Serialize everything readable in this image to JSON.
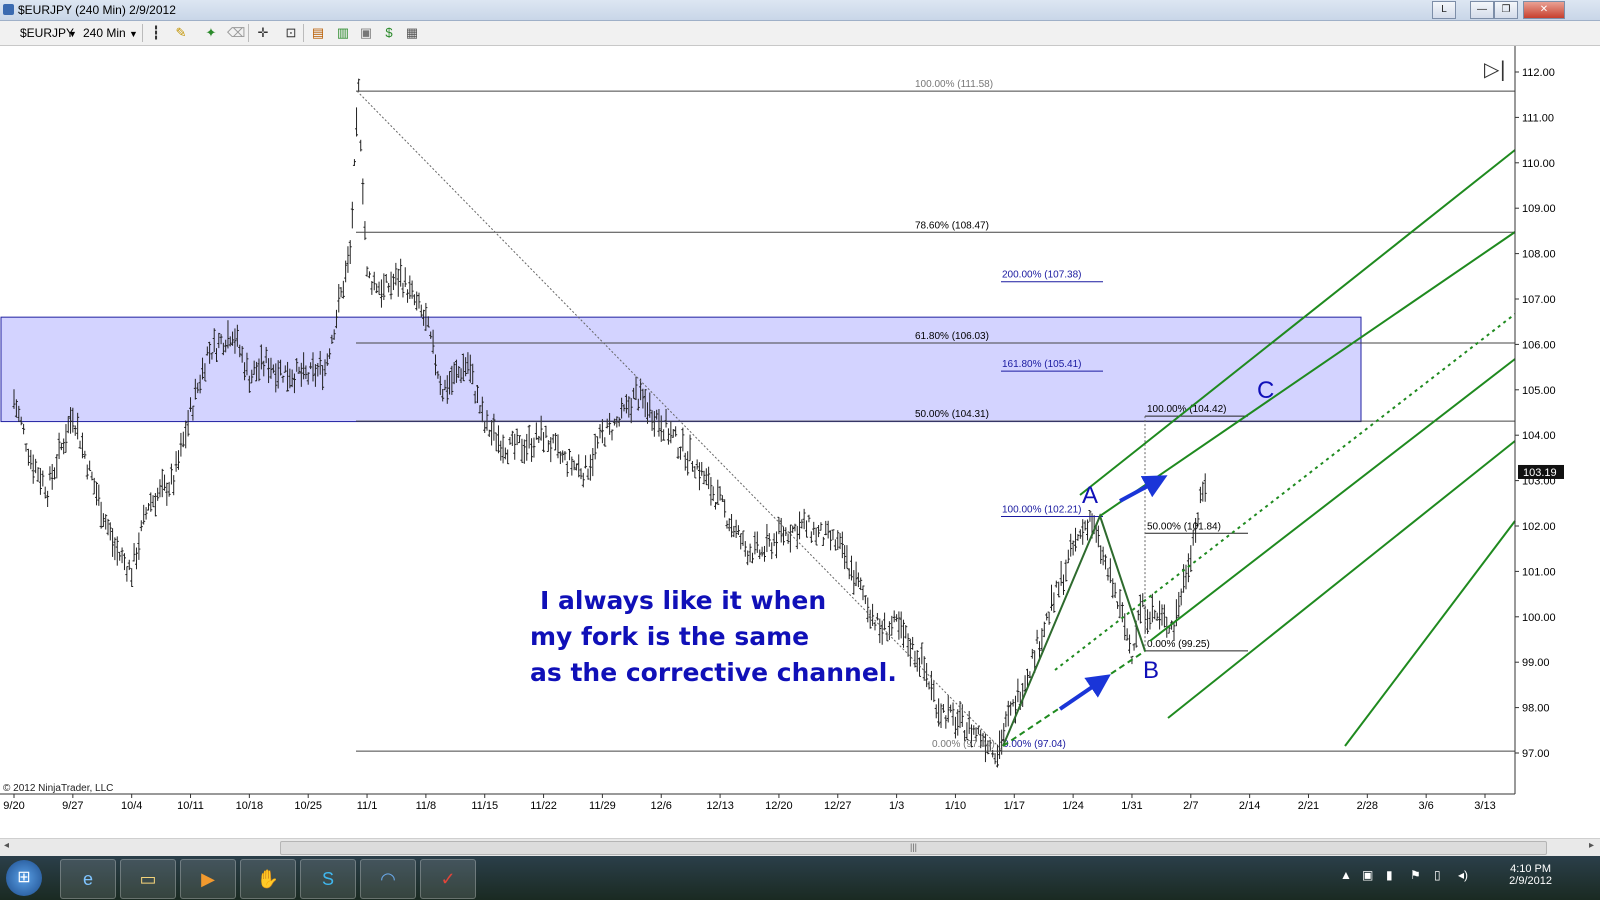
{
  "window": {
    "title": "$EURJPY (240 Min)  2/9/2012",
    "buttons": [
      "L",
      "—",
      "❐",
      "✕"
    ]
  },
  "toolbar": {
    "instrument": "$EURJPY",
    "interval": "240 Min",
    "icons": [
      "bar-type-icon",
      "pencil-icon",
      "magic-wand-icon",
      "eraser-icon",
      "crosshair-icon",
      "zoom-icon",
      "properties-icon",
      "strategy-icon",
      "chart-trader-icon",
      "dollar-icon",
      "data-box-icon"
    ]
  },
  "chart_data": {
    "type": "line",
    "title": "",
    "xlabel": "",
    "ylabel": "",
    "ylim": [
      96.7,
      112.3
    ],
    "yticks": [
      "112.00",
      "111.00",
      "110.00",
      "109.00",
      "108.00",
      "107.00",
      "106.00",
      "105.00",
      "104.00",
      "103.00",
      "102.00",
      "101.00",
      "100.00",
      "99.00",
      "98.00",
      "97.00"
    ],
    "xticks": [
      "9/20",
      "9/27",
      "10/4",
      "10/11",
      "10/18",
      "10/25",
      "11/1",
      "11/8",
      "11/15",
      "11/22",
      "11/29",
      "12/6",
      "12/13",
      "12/20",
      "12/27",
      "1/3",
      "1/10",
      "1/17",
      "1/24",
      "1/31",
      "2/7",
      "2/14",
      "2/21",
      "2/28",
      "3/6",
      "3/13"
    ],
    "last_price": "103.19",
    "copyright": "© 2012 NinjaTrader, LLC",
    "series": [
      {
        "x": [
          "9/20",
          "9/22",
          "9/24",
          "9/27",
          "9/29",
          "10/2",
          "10/4",
          "10/6",
          "10/9",
          "10/11",
          "10/13",
          "10/16",
          "10/18",
          "10/20",
          "10/22",
          "10/25",
          "10/27",
          "10/30",
          "10/31",
          "11/1",
          "11/3",
          "11/5",
          "11/8",
          "11/10",
          "11/13",
          "11/15",
          "11/18",
          "11/20",
          "11/22",
          "11/24",
          "11/27",
          "11/29",
          "12/1",
          "12/3",
          "12/6",
          "12/8",
          "12/10",
          "12/13",
          "12/16",
          "12/18",
          "12/20",
          "12/23",
          "12/25",
          "12/27",
          "12/30",
          "1/1",
          "1/3",
          "1/6",
          "1/8",
          "1/10",
          "1/13",
          "1/15",
          "1/16",
          "1/18",
          "1/20",
          "1/22",
          "1/24",
          "1/26",
          "1/27",
          "1/29",
          "1/31",
          "2/1",
          "2/3",
          "2/5",
          "2/7",
          "2/9"
        ],
        "values": [
          104.8,
          103.5,
          102.8,
          104.5,
          103.2,
          101.5,
          101.0,
          102.5,
          103.0,
          104.5,
          105.8,
          106.3,
          105.3,
          105.6,
          105.4,
          105.3,
          105.5,
          108.0,
          111.58,
          107.5,
          107.2,
          107.5,
          106.5,
          105.0,
          105.6,
          104.2,
          103.7,
          103.8,
          104.0,
          103.5,
          103.2,
          104.0,
          104.3,
          104.9,
          104.3,
          103.8,
          103.4,
          102.5,
          101.5,
          101.4,
          101.8,
          102.0,
          101.8,
          101.6,
          100.5,
          99.7,
          99.8,
          99.0,
          98.0,
          97.7,
          97.4,
          97.04,
          97.6,
          98.5,
          99.5,
          100.5,
          101.5,
          102.21,
          101.6,
          100.5,
          99.25,
          100.2,
          100.0,
          99.8,
          101.5,
          103.19
        ]
      }
    ],
    "fibonacci_retracement": [
      {
        "label": "100.00% (111.58)",
        "value": 111.58
      },
      {
        "label": "78.60% (108.47)",
        "value": 108.47
      },
      {
        "label": "61.80% (106.03)",
        "value": 106.03
      },
      {
        "label": "50.00% (104.31)",
        "value": 104.31
      },
      {
        "label": "0.00% (97.04)",
        "value": 97.04
      }
    ],
    "fibonacci_extension": [
      {
        "label": "200.00% (107.38)",
        "value": 107.38
      },
      {
        "label": "161.80% (105.41)",
        "value": 105.41
      },
      {
        "label": "100.00% (102.21)",
        "value": 102.21
      },
      {
        "label": "0.00% (97.04)",
        "value": 97.04
      }
    ],
    "abc_fib": [
      {
        "label": "100.00% (104.42)",
        "value": 104.42
      },
      {
        "label": "50.00% (101.84)",
        "value": 101.84
      },
      {
        "label": "0.00% (99.25)",
        "value": 99.25
      }
    ],
    "zone": {
      "from": 104.3,
      "to": 106.6
    },
    "wave_labels": [
      "A",
      "B",
      "C"
    ],
    "annotation": [
      "I always like it when",
      "my fork is the same",
      "as the corrective channel."
    ],
    "colors": {
      "bars": "#222222",
      "zone": "#8080ff",
      "fork": "#1f8a1f",
      "extension": "#1a1aa0",
      "arrows": "#1a35d8",
      "text": "#1010b8"
    }
  },
  "taskbar": {
    "time": "4:10 PM",
    "date": "2/9/2012",
    "apps": [
      "internet-explorer-icon",
      "file-explorer-icon",
      "media-player-icon",
      "hand-icon",
      "skype-icon",
      "app-icon",
      "ninjatrader-icon"
    ]
  }
}
